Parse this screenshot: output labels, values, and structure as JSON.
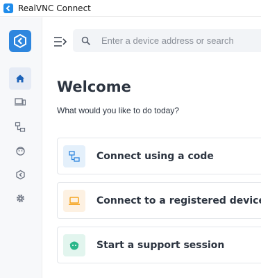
{
  "window": {
    "title": "RealVNC Connect"
  },
  "sidebar": {
    "items": [
      {
        "id": "home",
        "icon": "home-icon",
        "active": true
      },
      {
        "id": "devices",
        "icon": "devices-icon",
        "active": false
      },
      {
        "id": "connections",
        "icon": "network-icon",
        "active": false
      },
      {
        "id": "support",
        "icon": "support-icon",
        "active": false
      },
      {
        "id": "cloud",
        "icon": "realvnc-cube-icon",
        "active": false
      },
      {
        "id": "settings",
        "icon": "gear-icon",
        "active": false
      }
    ]
  },
  "search": {
    "placeholder": "Enter a device address or search",
    "value": ""
  },
  "main": {
    "title": "Welcome",
    "subtitle": "What would you like to do today?",
    "cards": [
      {
        "label": "Connect using a code",
        "icon": "connect-code-icon",
        "color": "#2e86de"
      },
      {
        "label": "Connect to a registered device",
        "icon": "laptop-icon",
        "color": "#f5a623"
      },
      {
        "label": "Start a support session",
        "icon": "support-session-icon",
        "color": "#2bb78a"
      }
    ]
  },
  "colors": {
    "brand": "#2e86de",
    "active_nav": "#e6ebf5"
  }
}
